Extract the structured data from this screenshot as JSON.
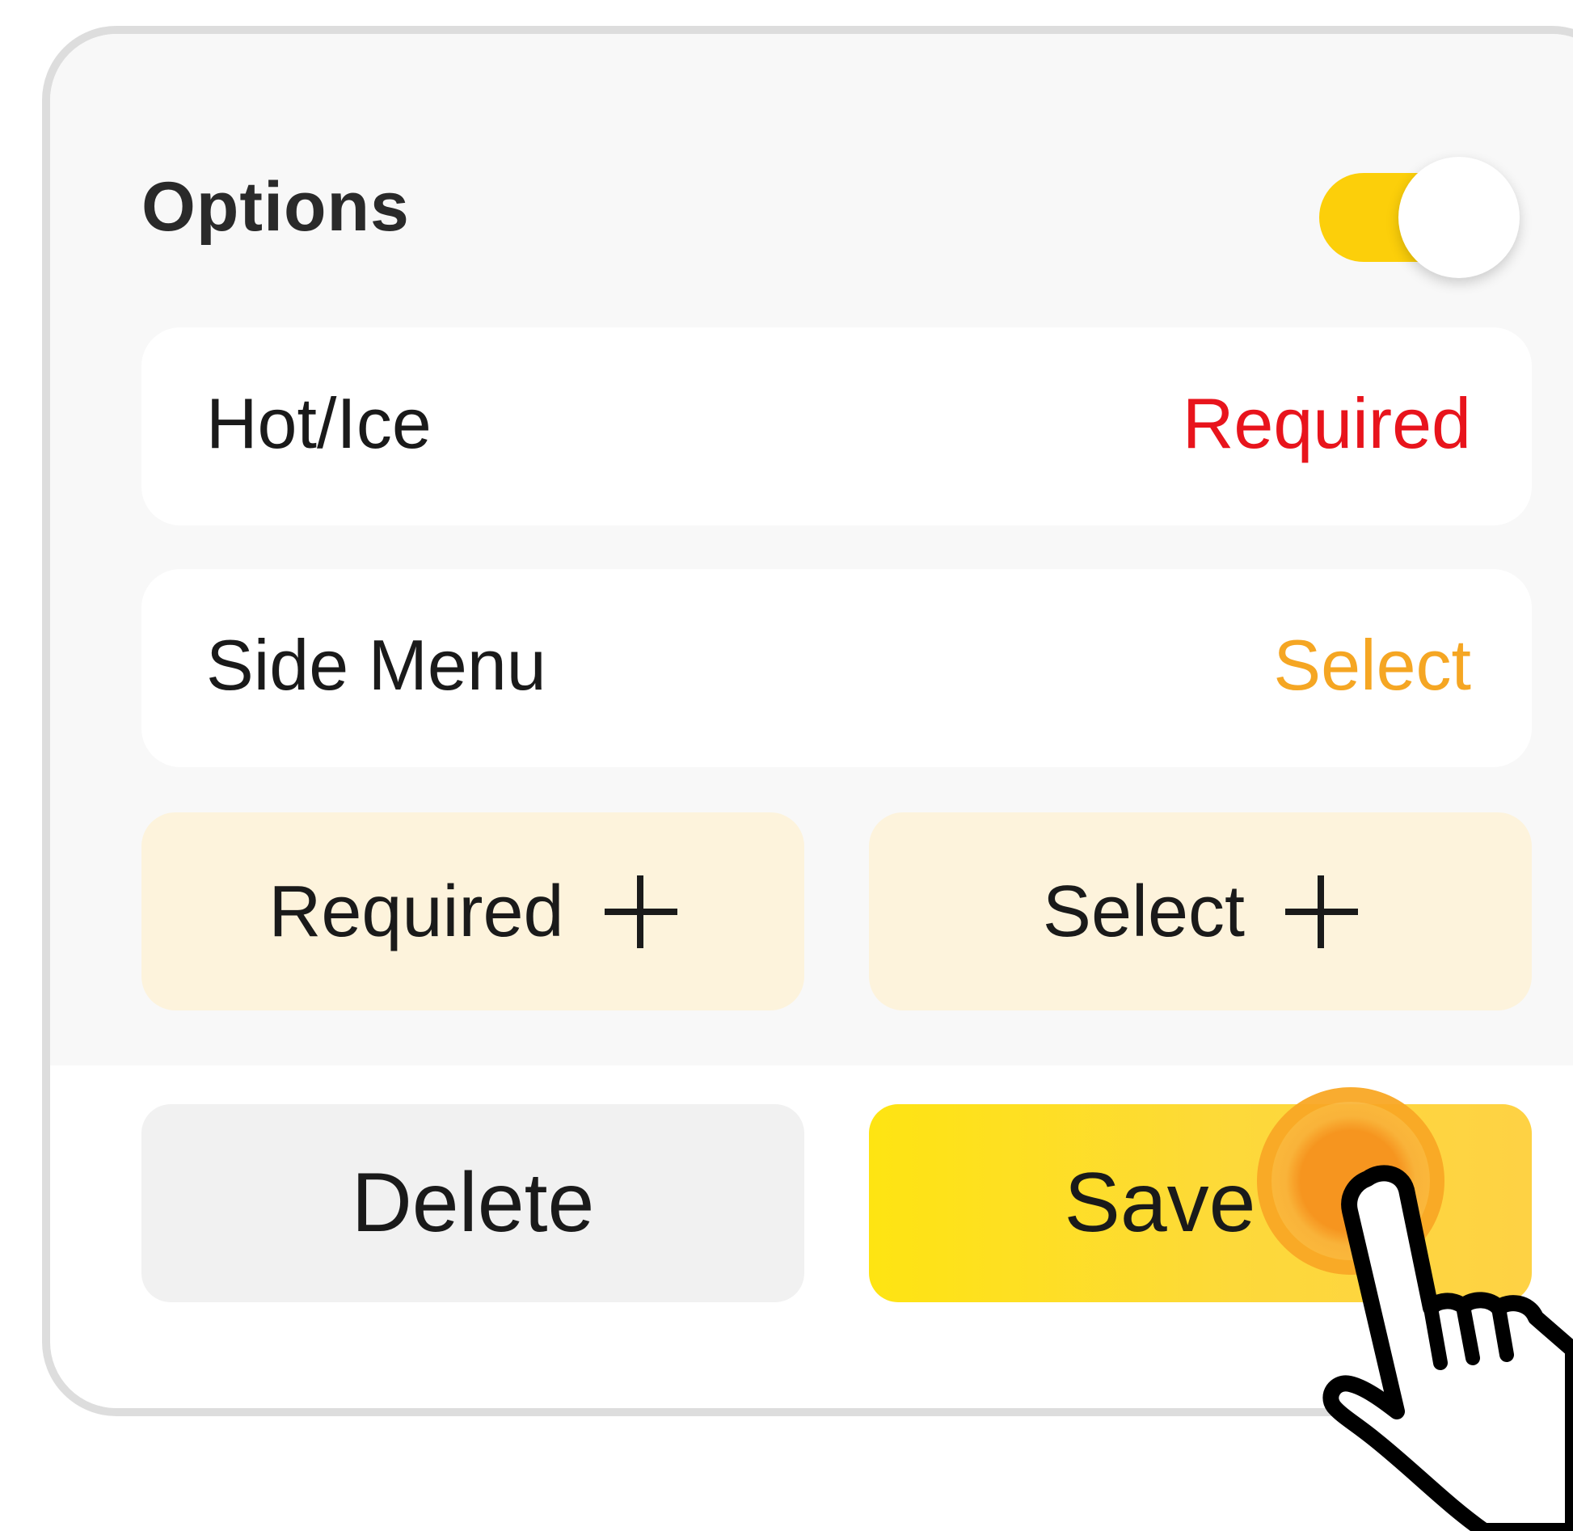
{
  "card": {
    "title": "Options",
    "toggle": {
      "state": "on",
      "color": "#fccf0a"
    }
  },
  "rows": [
    {
      "label": "Hot/Ice",
      "value": "Required",
      "value_color": "#e8141c"
    },
    {
      "label": "Side Menu",
      "value": "Select",
      "value_color": "#f5a623"
    }
  ],
  "add_buttons": [
    {
      "label": "Required",
      "icon": "plus-icon"
    },
    {
      "label": "Select",
      "icon": "plus-icon"
    }
  ],
  "actions": {
    "delete_label": "Delete",
    "save_label": "Save"
  },
  "colors": {
    "accent": "#fccf0a",
    "required": "#e8141c",
    "select": "#f5a623",
    "add_button_bg": "#fdf3dc",
    "save_bg": "#fee412",
    "delete_bg": "#f1f1f1"
  },
  "overlay": {
    "pointer": "tap-hand-icon"
  }
}
